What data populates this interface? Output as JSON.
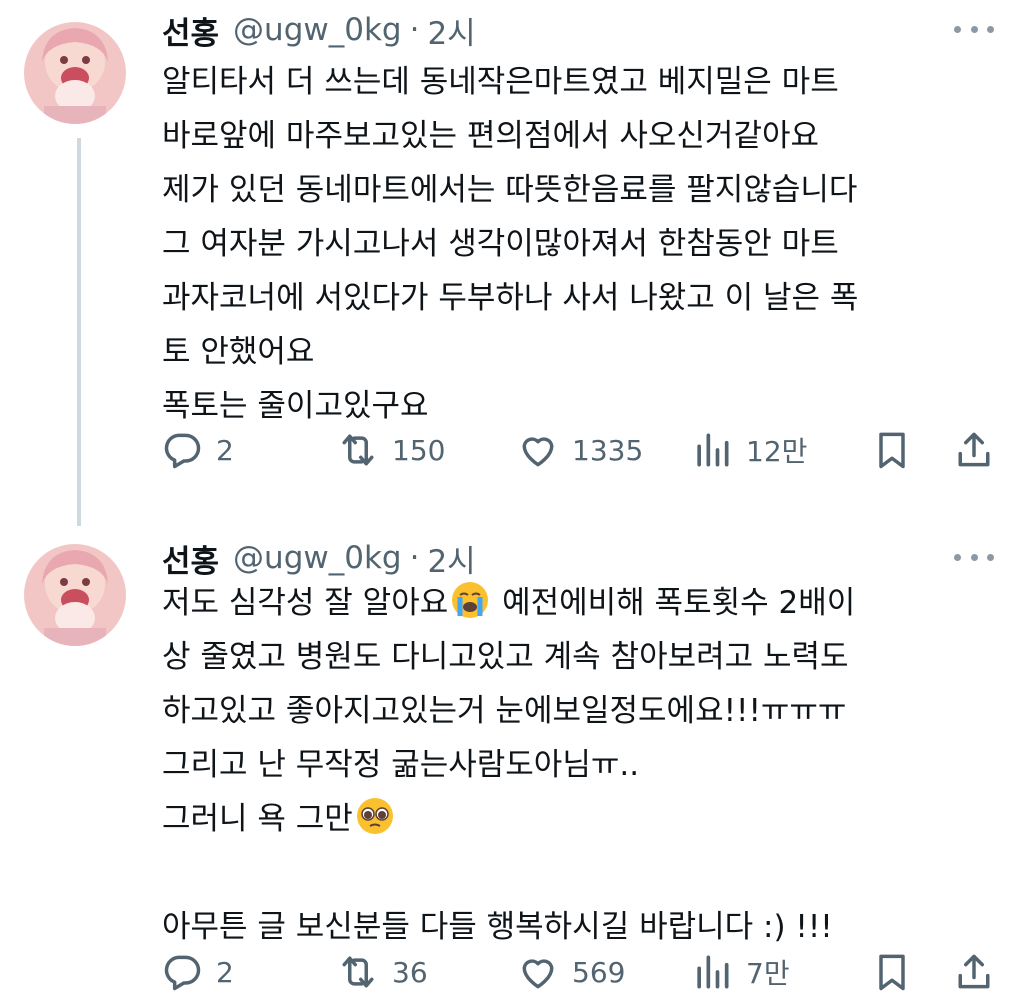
{
  "tweets": [
    {
      "author": {
        "name": "선홍",
        "handle": "@ugw_0kg",
        "time": "2시"
      },
      "lines": [
        "알티타서 더 쓰는데 동네작은마트였고 베지밀은 마트",
        "바로앞에 마주보고있는 편의점에서 사오신거같아요",
        "제가 있던 동네마트에서는 따뜻한음료를 팔지않습니다",
        "그 여자분 가시고나서 생각이많아져서 한참동안 마트",
        "과자코너에 서있다가 두부하나 사서 나왔고 이 날은 폭",
        "토 안했어요",
        "폭토는 줄이고있구요"
      ],
      "stats": {
        "replies": "2",
        "retweets": "150",
        "likes": "1335",
        "views": "12만"
      }
    },
    {
      "author": {
        "name": "선홍",
        "handle": "@ugw_0kg",
        "time": "2시"
      },
      "lines": [
        {
          "before": "저도 심각성 잘 알아요",
          "emoji": "loudly-crying-face-emoji",
          "after": " 예전에비해 폭토횟수 2배이"
        },
        "상 줄였고 병원도 다니고있고 계속 참아보려고 노력도",
        "하고있고 좋아지고있는거 눈에보일정도에요!!!ㅠㅠㅠ",
        "그리고 난 무작정 굶는사람도아님ㅠ..",
        {
          "before": "그러니 욕 그만",
          "emoji": "pleading-face-emoji",
          "after": ""
        },
        "",
        "아무튼 글 보신분들 다들 행복하시길 바랍니다 :) !!!"
      ],
      "stats": {
        "replies": "2",
        "retweets": "36",
        "likes": "569",
        "views": "7만"
      }
    }
  ],
  "colors": {
    "text": "#0f1419",
    "secondary": "#536471",
    "thread_line": "#cfd9de",
    "emoji_yellow": "#fbc02d",
    "tear_blue": "#42a5f5"
  },
  "icons": [
    "reply-icon",
    "retweet-icon",
    "like-icon",
    "views-icon",
    "bookmark-icon",
    "share-icon",
    "more-icon"
  ]
}
